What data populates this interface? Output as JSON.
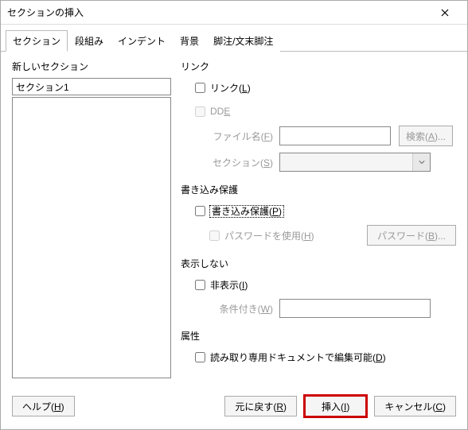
{
  "title": "セクションの挿入",
  "tabs": [
    "セクション",
    "段組み",
    "インデント",
    "背景",
    "脚注/文末脚注"
  ],
  "left": {
    "label": "新しいセクション",
    "section_value": "セクション1"
  },
  "link": {
    "group": "リンク",
    "link_label": "リンク(L)",
    "dde_label": "DDE",
    "filename_label": "ファイル名(F)",
    "browse": "検索(A)...",
    "section_label": "セクション(S)"
  },
  "protect": {
    "group": "書き込み保護",
    "protect_label": "書き込み保護(P)",
    "usepw_label": "パスワードを使用(H)",
    "pw_btn": "パスワード(B)..."
  },
  "hide": {
    "group": "表示しない",
    "hide_label": "非表示(I)",
    "cond_label": "条件付き(W)"
  },
  "attr": {
    "group": "属性",
    "editable_label": "読み取り専用ドキュメントで編集可能(D)"
  },
  "footer": {
    "help": "ヘルプ(H)",
    "reset": "元に戻す(R)",
    "insert": "挿入(I)",
    "cancel": "キャンセル(C)"
  }
}
